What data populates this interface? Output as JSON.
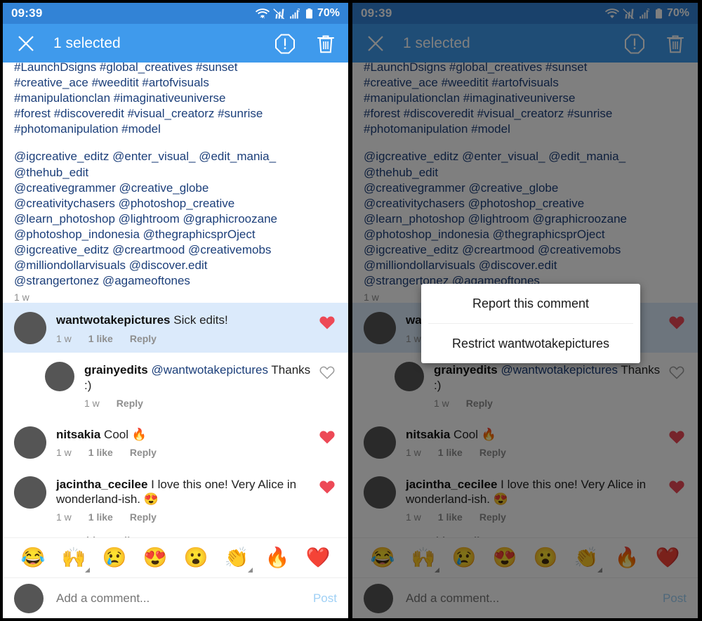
{
  "status_bar": {
    "time": "09:39",
    "battery": "70%",
    "sim_badge": "2"
  },
  "action_bar": {
    "title": "1 selected",
    "close_icon": "close-icon",
    "report_icon": "report-octagon-icon",
    "delete_icon": "trash-icon"
  },
  "caption": {
    "lines": [
      "#LaunchDsigns #global_creatives #sunset",
      "#creative_ace #weeditit #artofvisuals",
      "#manipulationclan #imaginativeuniverse",
      "#forest #discoveredit #visual_creatorz #sunrise",
      "#photomanipulation #model"
    ],
    "mention_lines": [
      "@igcreative_editz @enter_visual_ @edit_mania_",
      "@thehub_edit",
      "@creativegrammer @creative_globe",
      "@creativitychasers @photoshop_creative",
      "@learn_photoshop @lightroom @graphicroozane",
      "@photoshop_indonesia @thegraphicsprOject",
      "@igcreative_editz @creartmood @creativemobs",
      "@milliondollarvisuals @discover.edit",
      "@strangertonez @agameoftones"
    ],
    "timestamp": "1 w"
  },
  "comments": [
    {
      "username": "wantwotakepictures",
      "text": "Sick edits!",
      "mention": "",
      "time": "1 w",
      "likes": "1 like",
      "reply": "Reply",
      "liked": true,
      "selected": true,
      "is_reply": false,
      "avatar": "av-photographer"
    },
    {
      "username": "grainyedits",
      "mention": "@wantwotakepictures",
      "text": "Thanks :)",
      "time": "1 w",
      "likes": "",
      "reply": "Reply",
      "liked": false,
      "selected": false,
      "is_reply": true,
      "avatar": "av-tree"
    },
    {
      "username": "nitsakia",
      "text": "Cool 🔥",
      "mention": "",
      "time": "1 w",
      "likes": "1 like",
      "reply": "Reply",
      "liked": true,
      "selected": false,
      "is_reply": false,
      "avatar": "av-night"
    },
    {
      "username": "jacintha_cecilee",
      "text": "I love this one! Very Alice in wonderland-ish. 😍",
      "mention": "",
      "time": "1 w",
      "likes": "1 like",
      "reply": "Reply",
      "liked": true,
      "selected": false,
      "is_reply": false,
      "avatar": "av-girls"
    }
  ],
  "hide_replies_label": "Hide Replies",
  "emoji_bar": {
    "emojis": [
      "😂",
      "🙌",
      "😢",
      "😍",
      "😮",
      "👏",
      "🔥",
      "❤️"
    ]
  },
  "comment_input": {
    "placeholder": "Add a comment...",
    "post_label": "Post",
    "avatar": "av-dark-figure"
  },
  "dialog": {
    "items": [
      {
        "label": "Report this comment"
      },
      {
        "label": "Restrict wantwotakepictures"
      }
    ]
  },
  "colors": {
    "status_bar": "#3283d6",
    "action_bar": "#3f9aec",
    "selected_row": "#dbeafb",
    "link_text": "#1c3f7a",
    "heart_liked": "#ed4956",
    "post_label": "#9fd0f5"
  }
}
